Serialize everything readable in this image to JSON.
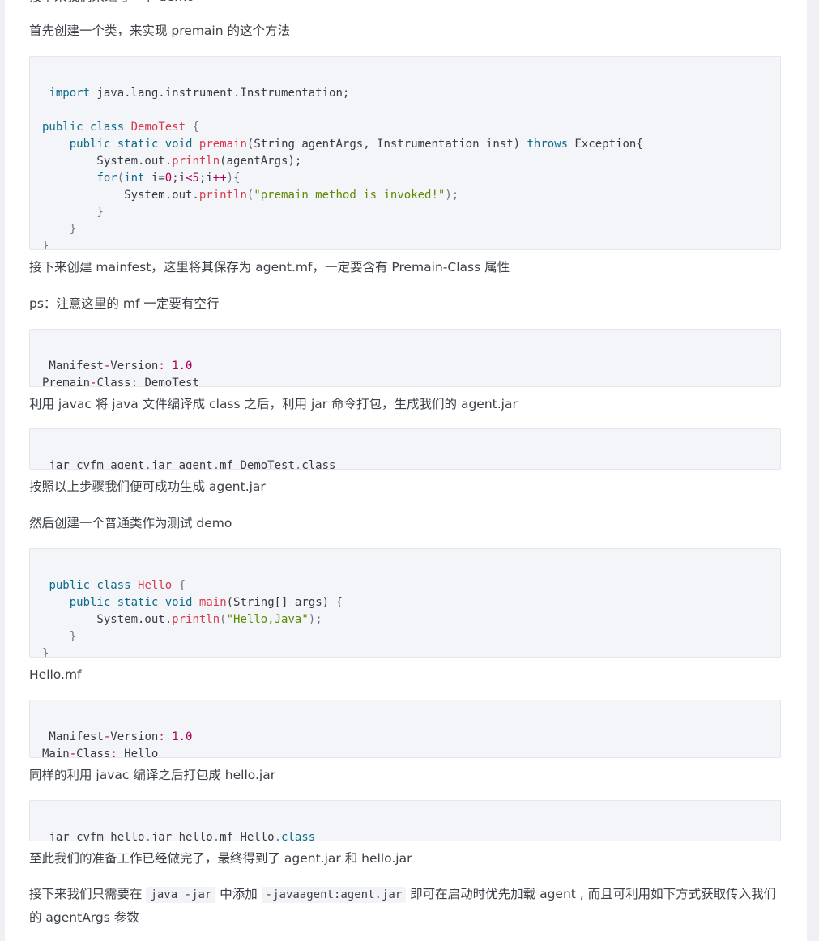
{
  "paragraphs": {
    "p0": "接下来我们来编写一个 demo",
    "p1": "首先创建一个类，来实现 premain 的这个方法",
    "p2": "接下来创建 mainfest，这里将其保存为 agent.mf，一定要含有 Premain-Class 属性",
    "p3": "ps：注意这里的 mf 一定要有空行",
    "p4": "利用 javac 将 java 文件编译成 class 之后，利用 jar 命令打包，生成我们的 agent.jar",
    "p5": "按照以上步骤我们便可成功生成 agent.jar",
    "p6": "然后创建一个普通类作为测试 demo",
    "p7": "Hello.mf",
    "p8": "同样的利用 javac 编译之后打包成 hello.jar",
    "p9": "至此我们的准备工作已经做完了，最终得到了 agent.jar 和 hello.jar",
    "p10_a": "接下来我们只需要在 ",
    "p10_code1": "java -jar",
    "p10_b": " 中添加 ",
    "p10_code2": "-javaagent:agent.jar",
    "p10_c": " 即可在启动时优先加载 agent , 而且可利用如下方式获取传入我们的 agentArgs 参数"
  },
  "code_blocks": {
    "demotest": {
      "l1": [
        "import",
        " java.lang.instrument.Instrumentation;"
      ],
      "l3": [
        "public",
        " ",
        "class",
        " ",
        "DemoTest",
        " {"
      ],
      "l4": [
        "    ",
        "public",
        " ",
        "static",
        " ",
        "void",
        " ",
        "premain",
        "(String agentArgs, Instrumentation inst) ",
        "throws",
        " Exception{"
      ],
      "l5": [
        "        System.out.",
        "println",
        "(agentArgs);"
      ],
      "l6": [
        "        ",
        "for",
        "(",
        "int",
        " i=",
        "0",
        ";i",
        "<",
        "5",
        ";i",
        "++",
        "){"
      ],
      "l7": [
        "            System.out.",
        "println",
        "(",
        "\"premain method is invoked!\"",
        ");"
      ],
      "l8": "        }",
      "l9": "    }",
      "l10": "}"
    },
    "agent_mf": {
      "l1": [
        " Manifest",
        "-",
        "Version",
        ":",
        " ",
        "1.0"
      ],
      "l2": [
        "Premain",
        "-",
        "Class",
        ":",
        " DemoTest"
      ]
    },
    "jar_agent": {
      "l1": [
        " jar cvfm agent",
        ".",
        "jar agent",
        ".",
        "mf DemoTest",
        ".",
        "class"
      ]
    },
    "hello": {
      "l1": [
        " ",
        "public",
        " ",
        "class",
        " ",
        "Hello",
        " {"
      ],
      "l2": [
        "    ",
        "public",
        " ",
        "static",
        " ",
        "void",
        " ",
        "main",
        "(String[] args) {"
      ],
      "l3": [
        "        System.out.",
        "println",
        "(",
        "\"Hello,Java\"",
        ");"
      ],
      "l4": "    }",
      "l5": "}"
    },
    "hello_mf": {
      "l1": [
        " Manifest",
        "-",
        "Version",
        ":",
        " ",
        "1.0"
      ],
      "l2": [
        "Main",
        "-",
        "Class",
        ":",
        " Hello"
      ]
    },
    "jar_hello": {
      "l1": [
        " jar cvfm hello",
        ".",
        "jar hello",
        ".",
        "mf Hello",
        ".",
        "class"
      ]
    }
  },
  "colors": {
    "keyword": "#0c6a8a",
    "function": "#d6384e",
    "number": "#a8015b",
    "string": "#5c8a00",
    "code_background": "#f4f5f8"
  }
}
